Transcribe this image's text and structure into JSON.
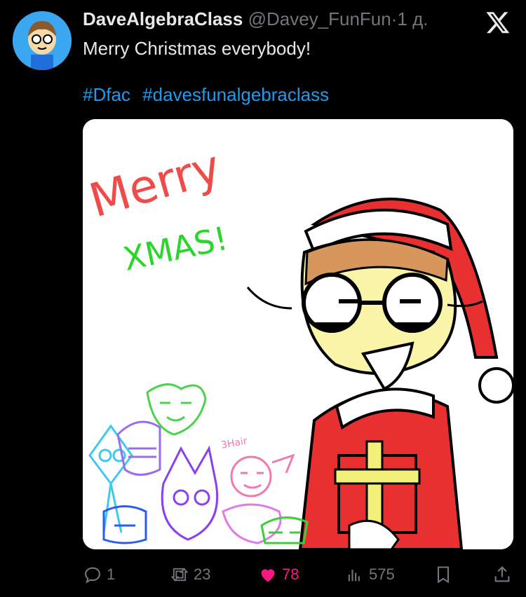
{
  "tweet": {
    "display_name": "DaveAlgebraClass",
    "handle": "@Davey_FunFun",
    "separator": "·",
    "time": "1 д.",
    "text": "Merry Christmas everybody!",
    "hashtags": [
      "#Dfac",
      "#davesfunalgebraclass"
    ]
  },
  "media": {
    "caption_line1": "Merry",
    "caption_line2": "XMAS!",
    "small_text": "3Hair"
  },
  "actions": {
    "replies": "1",
    "reposts": "23",
    "likes": "78",
    "views": "575"
  },
  "colors": {
    "like": "#f91880",
    "hashtag": "#1d9bf0",
    "avatar_bg": "#3aa7f0"
  }
}
